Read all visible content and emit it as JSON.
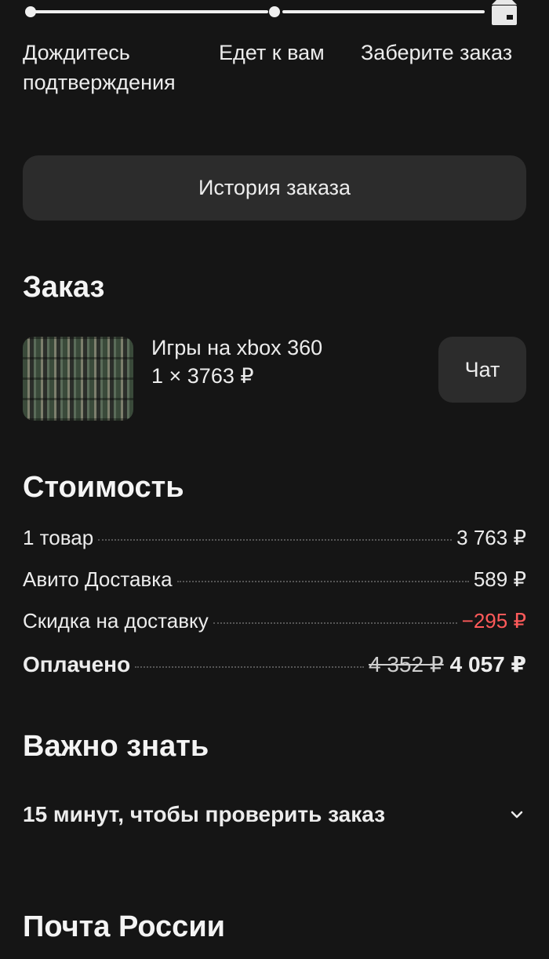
{
  "progress": {
    "steps": [
      "Дождитесь подтверждения",
      "Едет к вам",
      "Заберите заказ"
    ]
  },
  "history_button": "История заказа",
  "order": {
    "title": "Заказ",
    "item_title": "Игры на xbox 360",
    "item_qty": "1 × 3763 ₽",
    "chat_label": "Чат"
  },
  "cost": {
    "title": "Стоимость",
    "rows": [
      {
        "label": "1 товар",
        "value": "3 763 ₽"
      },
      {
        "label": "Авито Доставка",
        "value": "589 ₽"
      },
      {
        "label": "Скидка на доставку",
        "value": "−295 ₽"
      }
    ],
    "paid_label": "Оплачено",
    "paid_old": "4 352 ₽",
    "paid_value": "4 057 ₽"
  },
  "important": {
    "title": "Важно знать",
    "faq": "15 минут, чтобы проверить заказ"
  },
  "post": {
    "title": "Почта России"
  },
  "icons": {
    "box": "package-icon",
    "expand": "chevron-down-icon"
  },
  "colors": {
    "background": "#151515",
    "card": "#2c2c2c",
    "discount": "#ff5a5a"
  }
}
